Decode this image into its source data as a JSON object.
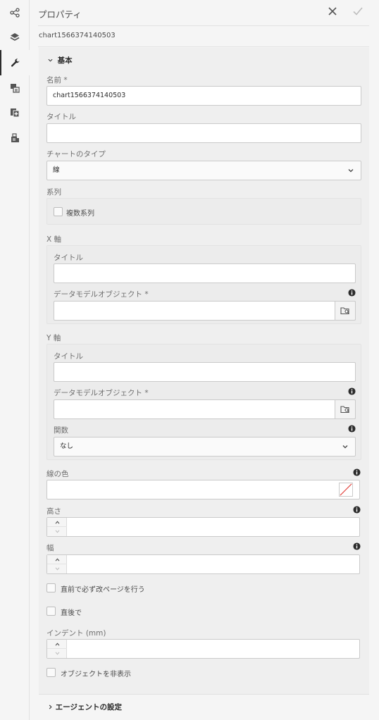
{
  "header": {
    "title": "プロパティ"
  },
  "component_id": "chart1566374140503",
  "section_basic": {
    "title": "基本",
    "name_label": "名前 *",
    "name_value": "chart1566374140503",
    "title_label": "タイトル",
    "title_value": "",
    "chart_type_label": "チャートのタイプ",
    "chart_type_value": "線",
    "series_label": "系列",
    "multi_series_label": "複数系列",
    "x_axis": {
      "label": "X 軸",
      "title_label": "タイトル",
      "data_model_label": "データモデルオブジェクト *"
    },
    "y_axis": {
      "label": "Y 軸",
      "title_label": "タイトル",
      "data_model_label": "データモデルオブジェクト *",
      "function_label": "関数",
      "function_value": "なし"
    },
    "line_color_label": "線の色",
    "height_label": "高さ",
    "width_label": "幅",
    "page_break_before_label": "直前で必ず改ページを行う",
    "page_break_after_label": "直後で",
    "indent_label": "インデント (mm)",
    "hide_object_label": "オブジェクトを非表示"
  },
  "section_agent": {
    "title": "エージェントの設定"
  },
  "rail_icons": [
    "share-icon",
    "layers-icon",
    "wrench-icon",
    "form-icon",
    "add-page-icon",
    "assets-icon"
  ]
}
